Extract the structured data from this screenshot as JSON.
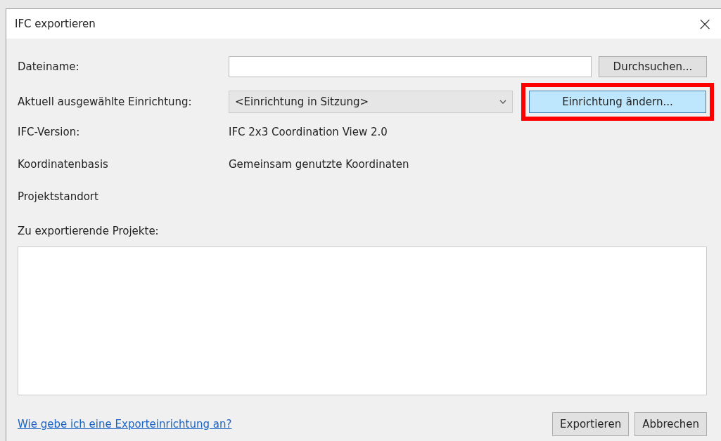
{
  "window": {
    "title": "IFC exportieren",
    "close": "×"
  },
  "filename": {
    "label": "Dateiname:",
    "browse": "Durchsuchen..."
  },
  "setup": {
    "label": "Aktuell ausgewählte Einrichtung:",
    "value": "<Einrichtung in Sitzung>",
    "change": {
      "label": "Einrichtung ändern...",
      "focused": true,
      "highlighted": true
    }
  },
  "info": [
    {
      "label": "IFC-Version:",
      "value": "IFC 2x3 Coordination View 2.0"
    },
    {
      "label": "Koordinatenbasis",
      "value": "Gemeinsam genutzte Koordinaten"
    },
    {
      "label": "Projektstandort"
    }
  ],
  "projects": {
    "label": "Zu exportierende Projekte:"
  },
  "help_link": "Wie gebe ich eine Exporteinrichtung an?",
  "buttons": [
    "Exportieren",
    "Abbrechen"
  ]
}
